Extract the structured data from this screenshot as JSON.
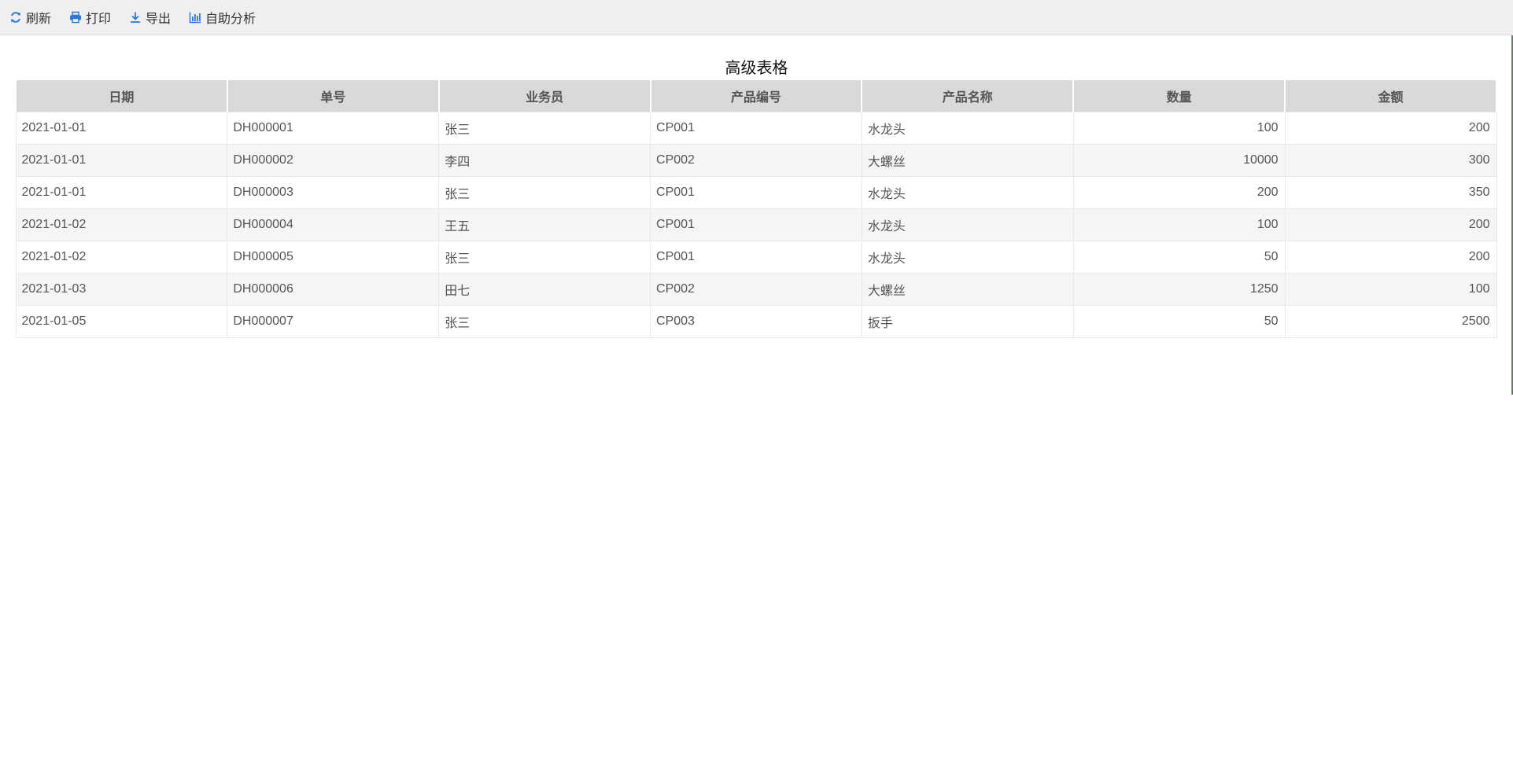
{
  "toolbar": {
    "buttons": [
      {
        "label": "刷新",
        "icon": "refresh-icon"
      },
      {
        "label": "打印",
        "icon": "print-icon"
      },
      {
        "label": "导出",
        "icon": "download-icon"
      },
      {
        "label": "自助分析",
        "icon": "bar-chart-icon"
      }
    ],
    "icon_color": "#2f7ad6"
  },
  "report": {
    "title": "高级表格",
    "columns": [
      "日期",
      "单号",
      "业务员",
      "产品编号",
      "产品名称",
      "数量",
      "金额"
    ],
    "rows": [
      [
        "2021-01-01",
        "DH000001",
        "张三",
        "CP001",
        "水龙头",
        "100",
        "200"
      ],
      [
        "2021-01-01",
        "DH000002",
        "李四",
        "CP002",
        "大螺丝",
        "10000",
        "300"
      ],
      [
        "2021-01-01",
        "DH000003",
        "张三",
        "CP001",
        "水龙头",
        "200",
        "350"
      ],
      [
        "2021-01-02",
        "DH000004",
        "王五",
        "CP001",
        "水龙头",
        "100",
        "200"
      ],
      [
        "2021-01-02",
        "DH000005",
        "张三",
        "CP001",
        "水龙头",
        "50",
        "200"
      ],
      [
        "2021-01-03",
        "DH000006",
        "田七",
        "CP002",
        "大螺丝",
        "1250",
        "100"
      ],
      [
        "2021-01-05",
        "DH000007",
        "张三",
        "CP003",
        "扳手",
        "50",
        "2500"
      ]
    ]
  }
}
